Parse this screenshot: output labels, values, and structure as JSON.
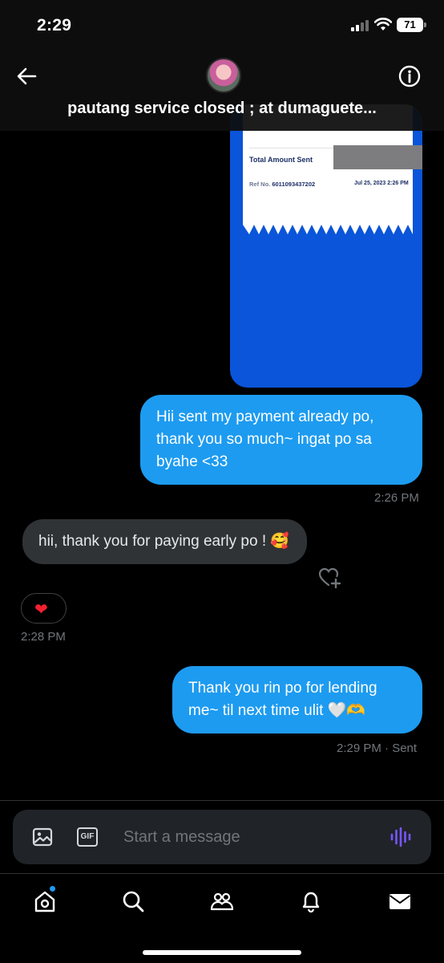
{
  "status_bar": {
    "time": "2:29",
    "battery": "71"
  },
  "header": {
    "title": "pautang service closed ; at dumaguete...",
    "back_icon": "arrow-left-icon",
    "info_icon": "info-icon"
  },
  "receipt": {
    "total_label": "Total Amount Sent",
    "ref_label": "Ref No.",
    "ref_number": "6011093437202",
    "date": "Jul 25, 2023 2:26 PM"
  },
  "messages": [
    {
      "type": "sent",
      "text": "Hii sent my payment already po, thank you so much~ ingat po sa byahe <33",
      "time": "2:26 PM"
    },
    {
      "type": "received",
      "text": "hii, thank you for paying early po ! 🥰",
      "time": "2:28 PM",
      "reaction": "❤"
    },
    {
      "type": "sent",
      "text": "Thank you rin po for lending me~ til next time ulit 🤍🫶",
      "time": "2:29 PM",
      "status": "· Sent"
    }
  ],
  "composer": {
    "placeholder": "Start a message",
    "gif_label": "GIF"
  },
  "nav": {
    "items": [
      "home-icon",
      "search-icon",
      "communities-icon",
      "bell-icon",
      "mail-icon"
    ]
  },
  "colors": {
    "accent": "#1d9bf0",
    "received_bubble": "#2f3336",
    "receipt_blue": "#0a55d9",
    "voice": "#7856ff"
  }
}
